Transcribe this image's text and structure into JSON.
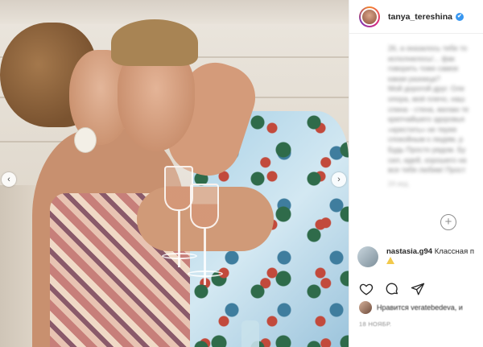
{
  "profile": {
    "username": "tanya_tereshina",
    "verified_mark": "✔",
    "avatar_icon": "profile-avatar"
  },
  "caption": {
    "lines": [
      "26, а оказалось тебе то",
      "исполнилось!... фак",
      "говорить тоже самое",
      "какая разница?",
      "Мой дорогой друг. Оле",
      "опора, моё плечо, наш",
      "спина - стена, желаю те",
      "крепчайшего здоровья",
      "«крестить» не теряя",
      "спокойным к людям, р",
      "Будь Просто рядом. Бу",
      "сил, идей, хорошего на",
      "все тебя любим! Прост"
    ],
    "timestamp": "24 нед."
  },
  "comment": {
    "username": "nastasia.g94",
    "text": "Классная п"
  },
  "likes": {
    "text": "Нравится veratebedeva, и"
  },
  "date": "18 НОЯБР.",
  "navigation": {
    "prev_glyph": "‹",
    "next_glyph": "›",
    "load_more_glyph": "+"
  },
  "colors": {
    "verified_blue": "#3897f0",
    "text_primary": "#262626",
    "text_secondary": "#8e8e8e",
    "divider": "#efefef"
  }
}
